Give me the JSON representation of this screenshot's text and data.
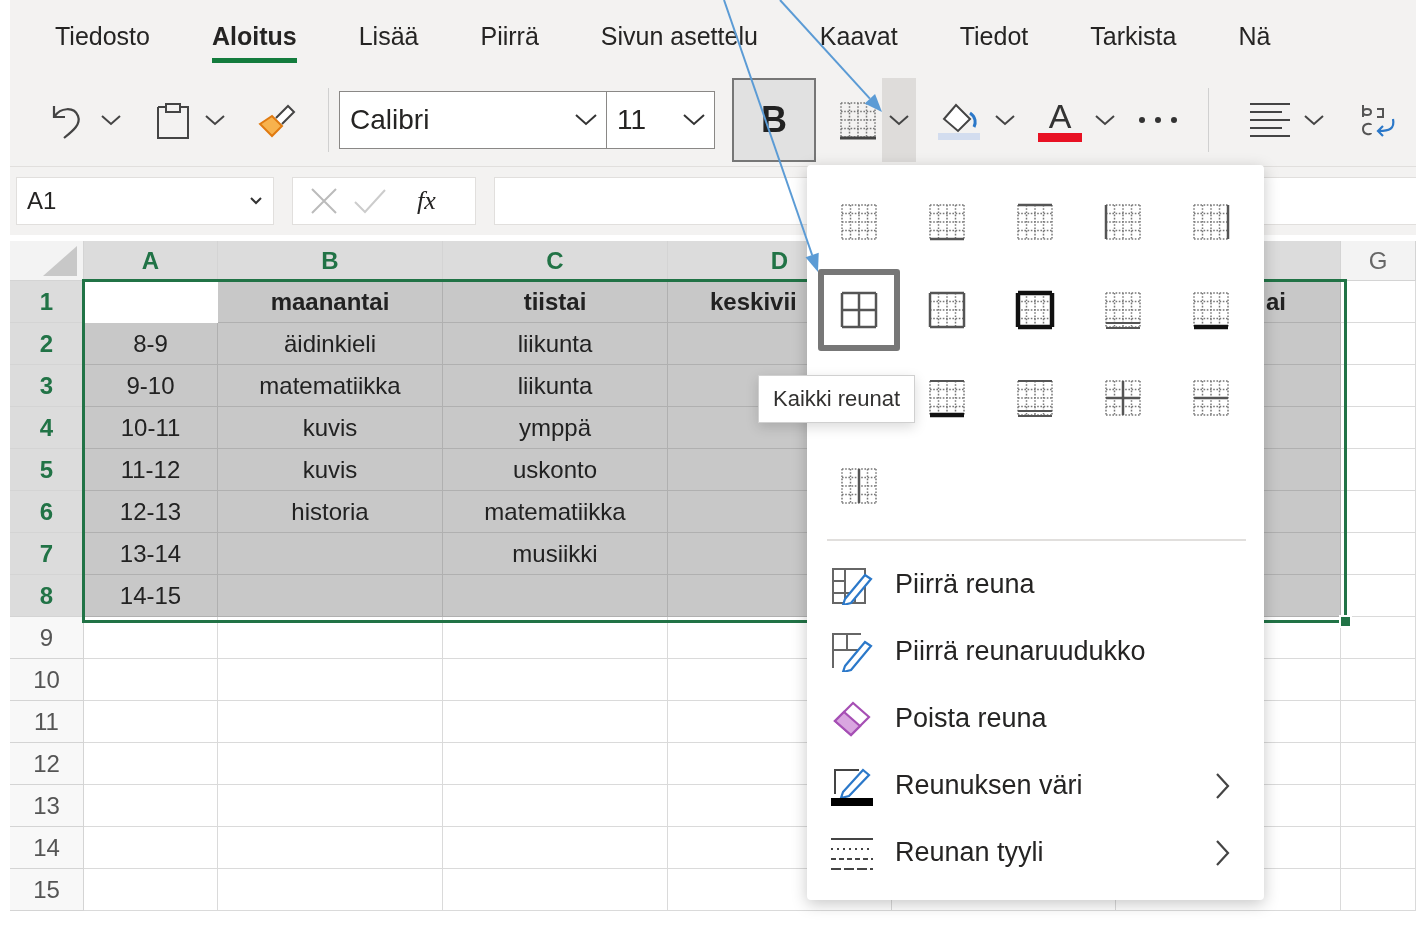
{
  "ribbon": {
    "tabs": [
      {
        "label": "Tiedosto",
        "selected": false
      },
      {
        "label": "Aloitus",
        "selected": true
      },
      {
        "label": "Lisää",
        "selected": false
      },
      {
        "label": "Piirrä",
        "selected": false
      },
      {
        "label": "Sivun asettelu",
        "selected": false
      },
      {
        "label": "Kaavat",
        "selected": false
      },
      {
        "label": "Tiedot",
        "selected": false
      },
      {
        "label": "Tarkista",
        "selected": false
      },
      {
        "label": "Nä",
        "selected": false
      }
    ]
  },
  "toolbar": {
    "font": "Calibri",
    "font_size": "11",
    "bold": {
      "label": "B",
      "on": true
    },
    "borders": {
      "expanded": true
    },
    "font_color": {
      "label": "A"
    }
  },
  "formula_bar": {
    "name_box": "A1",
    "function_label": "fx"
  },
  "sheet": {
    "columns": [
      {
        "label": "A",
        "selected": true
      },
      {
        "label": "B",
        "selected": true
      },
      {
        "label": "C",
        "selected": true
      },
      {
        "label": "D",
        "selected": true
      },
      {},
      {
        "selected": true
      },
      {
        "label": "G",
        "selected": false
      }
    ],
    "rows": [
      {
        "number": "1",
        "selected": true,
        "cells": [
          {
            "active": true
          },
          {
            "text": "maanantai",
            "bold": true,
            "active": false
          },
          {
            "text": "tiistai",
            "bold": true,
            "active": false
          },
          {
            "text": "keskivii",
            "bold": true,
            "active": false
          },
          null,
          {
            "text": "ai",
            "bold": true,
            "active": false
          }
        ]
      },
      {
        "number": "2",
        "selected": true,
        "cells": [
          {
            "text": "8-9",
            "bold": false,
            "active": false
          },
          {
            "text": "äidinkieli",
            "bold": false,
            "active": false
          },
          {
            "text": "liikunta",
            "bold": false,
            "active": false
          },
          {
            "active": false
          },
          null,
          {
            "active": false
          }
        ]
      },
      {
        "number": "3",
        "selected": true,
        "cells": [
          {
            "text": "9-10",
            "bold": false,
            "active": false
          },
          {
            "text": "matematiikka",
            "bold": false,
            "active": false
          },
          {
            "text": "liikunta",
            "bold": false,
            "active": false
          },
          {
            "active": false
          },
          null,
          {
            "active": false
          }
        ]
      },
      {
        "number": "4",
        "selected": true,
        "cells": [
          {
            "text": "10-11",
            "bold": false,
            "active": false
          },
          {
            "text": "kuvis",
            "bold": false,
            "active": false
          },
          {
            "text": "ymppä",
            "bold": false,
            "active": false
          },
          {
            "active": false
          },
          null,
          {
            "active": false
          }
        ]
      },
      {
        "number": "5",
        "selected": true,
        "cells": [
          {
            "text": "11-12",
            "bold": false,
            "active": false
          },
          {
            "text": "kuvis",
            "bold": false,
            "active": false
          },
          {
            "text": "uskonto",
            "bold": false,
            "active": false
          },
          {
            "active": false
          },
          null,
          {
            "active": false
          }
        ]
      },
      {
        "number": "6",
        "selected": true,
        "cells": [
          {
            "text": "12-13",
            "bold": false,
            "active": false
          },
          {
            "text": "historia",
            "bold": false,
            "active": false
          },
          {
            "text": "matematiikka",
            "bold": false,
            "active": false
          },
          {
            "active": false
          },
          null,
          {
            "active": false
          }
        ]
      },
      {
        "number": "7",
        "selected": true,
        "cells": [
          {
            "text": "13-14",
            "bold": false,
            "active": false
          },
          {
            "active": false
          },
          {
            "text": "musiikki",
            "bold": false,
            "active": false
          },
          {
            "active": false
          },
          null,
          {
            "active": false
          }
        ]
      },
      {
        "number": "8",
        "selected": true,
        "cells": [
          {
            "text": "14-15",
            "bold": false,
            "active": false
          },
          {
            "active": false
          },
          {
            "active": false
          },
          {
            "active": false
          },
          null,
          {
            "active": false
          }
        ]
      },
      {
        "number": "9",
        "selected": false
      },
      {
        "number": "10",
        "selected": false
      },
      {
        "number": "11",
        "selected": false
      },
      {
        "number": "12",
        "selected": false
      },
      {
        "number": "13",
        "selected": false
      },
      {
        "number": "14",
        "selected": false
      },
      {
        "number": "15",
        "selected": false
      }
    ]
  },
  "borders_menu": {
    "presets": [
      {
        "kind": "none",
        "selected": false
      },
      {
        "kind": "bottom",
        "selected": false
      },
      {
        "kind": "top",
        "selected": false
      },
      {
        "kind": "left",
        "selected": false
      },
      {
        "kind": "right",
        "selected": false
      },
      {
        "kind": "all",
        "selected": true
      },
      {
        "kind": "outside",
        "selected": false
      },
      {
        "kind": "thick-outside",
        "selected": false
      },
      {
        "kind": "double-bottom",
        "selected": false
      },
      {
        "kind": "thick-bottom",
        "selected": false
      },
      {
        "kind": "top-thick-bottom",
        "selected": false
      },
      {
        "kind": "top-double-bottom",
        "selected": false
      },
      {
        "kind": "inside",
        "selected": false
      },
      {
        "kind": "inside-horizontal",
        "selected": false
      },
      {
        "kind": "inside-vertical",
        "selected": false
      }
    ],
    "tooltip": "Kaikki reunat",
    "items": [
      {
        "label": "Piirrä reuna",
        "kind": "draw-border",
        "submenu": false
      },
      {
        "label": "Piirrä reunaruudukko",
        "kind": "draw-grid",
        "submenu": false
      },
      {
        "label": "Poista reuna",
        "kind": "erase",
        "submenu": false
      },
      {
        "label": "Reunuksen väri",
        "kind": "line-color",
        "submenu": true
      },
      {
        "label": "Reunan tyyli",
        "kind": "line-style",
        "submenu": true
      }
    ]
  }
}
